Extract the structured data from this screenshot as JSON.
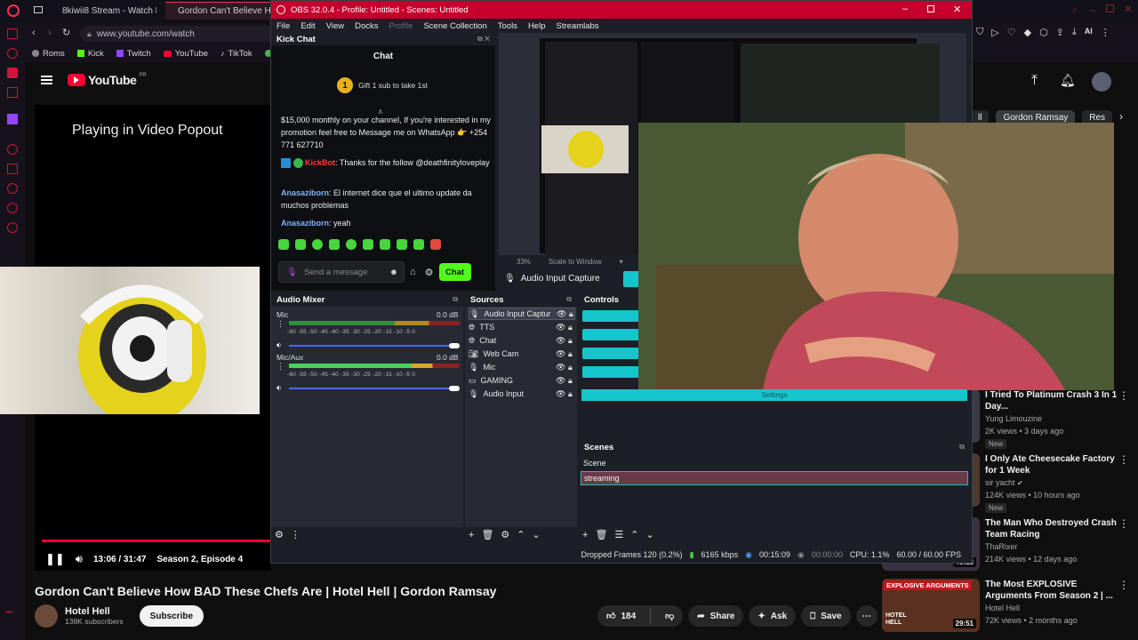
{
  "browser": {
    "tabs": [
      {
        "label": "8kiwii8 Stream - Watch Liv"
      },
      {
        "label": "Gordon Can't Believe H"
      }
    ],
    "address": "www.youtube.com/watch",
    "bookmarks": [
      "Roms",
      "Kick",
      "Twitch",
      "YouTube",
      "TikTok",
      "T"
    ],
    "colors": {
      "accent": "#ff2d55"
    }
  },
  "youtube": {
    "logo_text": "YouTube",
    "logo_sup": "PR",
    "player_message": "Playing in Video Popout",
    "time": "13:06 / 31:47",
    "chapter": "Season 2, Episode 4",
    "title": "Gordon Can't Believe How BAD These Chefs Are | Hotel Hell | Gordon Ramsay",
    "channel": "Hotel Hell",
    "subscribers": "138K subscribers",
    "subscribe_label": "Subscribe",
    "likes": "184",
    "share_label": "Share",
    "ask_label": "Ask",
    "save_label": "Save",
    "chips": [
      "ll",
      "Gordon Ramsay",
      "Res"
    ],
    "recommendations": [
      {
        "title": "I Tried To Platinum Crash 3 In 1 Day...",
        "channel": "Yung Limouzine",
        "meta": "2K views • 3 days ago",
        "badge": "New",
        "duration": ""
      },
      {
        "title": "I Only Ate Cheesecake Factory for 1 Week",
        "channel": "sir yacht",
        "meta": "124K views • 10 hours ago",
        "badge": "New",
        "duration": ""
      },
      {
        "title": "The Man Who Destroyed Crash Team Racing",
        "channel": "ThaRixer",
        "meta": "214K views • 12 days ago",
        "badge": "",
        "duration": "46:13"
      },
      {
        "title": "The Most EXPLOSIVE Arguments From Season 2 | ...",
        "channel": "Hotel Hell",
        "meta": "72K views • 2 months ago",
        "badge": "",
        "duration": "29:51",
        "thumb_caption": "EXPLOSIVE ARGUMENTS",
        "thumb_logo": "HOTEL HELL"
      }
    ]
  },
  "obs": {
    "title": "OBS 32.0.4 - Profile: Untitled - Scenes: Untitled",
    "menu": [
      "File",
      "Edit",
      "View",
      "Docks",
      "Profile",
      "Scene Collection",
      "Tools",
      "Help",
      "Streamlabs"
    ],
    "kick_dock_title": "Kick Chat",
    "chat": {
      "header": "Chat",
      "gift_rank": "1",
      "gift_text": "Gift 1 sub to take 1st",
      "messages": [
        {
          "user": "",
          "text": "$15,000 monthly on your channel, If you're interested in my promotion feel free to Message me on WhatsApp 👉 +254 771 627710"
        },
        {
          "user": "KickBot",
          "text": ": Thanks for the follow @deathfinityloveplay"
        },
        {
          "user": "Anasaziborn",
          "text": ": El internet dice que el ultimo update da muchos problemas"
        },
        {
          "user": "Anasaziborn",
          "text": ": yeah"
        }
      ],
      "input_placeholder": "Send a message",
      "send_label": "Chat"
    },
    "preview": {
      "zoom": "33%",
      "scale_mode": "Scale to Window"
    },
    "audio_capture_label": "Audio Input Capture",
    "audio_mixer": {
      "title": "Audio Mixer",
      "channels": [
        {
          "name": "Mic",
          "db": "0.0 dB",
          "level": 0.6
        },
        {
          "name": "Mic/Aux",
          "db": "0.0 dB",
          "level": 0.72
        }
      ],
      "scale": [
        "-60",
        "-55",
        "-50",
        "-45",
        "-40",
        "-35",
        "-30",
        "-25",
        "-20",
        "-15",
        "-10",
        "-5",
        "0"
      ]
    },
    "sources": {
      "title": "Sources",
      "items": [
        {
          "name": "Audio Input Captur",
          "icon": "mic-icon",
          "selected": true
        },
        {
          "name": "TTS",
          "icon": "globe-icon"
        },
        {
          "name": "Chat",
          "icon": "globe-icon"
        },
        {
          "name": "Web Cam",
          "icon": "camera-icon"
        },
        {
          "name": "Mic",
          "icon": "mic-icon"
        },
        {
          "name": "GAMING",
          "icon": "monitor-icon"
        },
        {
          "name": "Audio Input",
          "icon": "mic-icon"
        }
      ]
    },
    "controls": {
      "title": "Controls",
      "settings_label": "Settings"
    },
    "scenes": {
      "title": "Scenes",
      "items": [
        {
          "name": "Scene",
          "selected": false
        },
        {
          "name": "streaming",
          "selected": true
        }
      ]
    },
    "status": {
      "dropped": "Dropped Frames 120 (0.2%)",
      "bitrate": "6165 kbps",
      "live_time": "00:15:09",
      "rec_time": "00:00:00",
      "cpu": "CPU: 1.1%",
      "fps": "60.00 / 60.00 FPS"
    },
    "colors": {
      "titlebar": "#c4002d",
      "control_buttons": "#16c5cc",
      "kick_green": "#53fc18"
    }
  }
}
